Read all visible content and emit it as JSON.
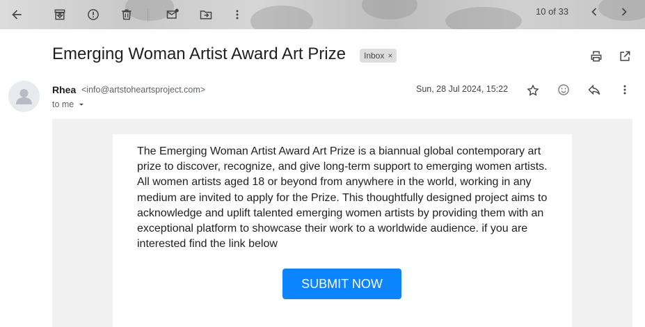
{
  "toolbar": {
    "buttons": [
      "back-icon",
      "archive-icon",
      "report-spam-icon",
      "delete-icon",
      "mark-unread-icon",
      "move-to-icon",
      "more-vert-icon"
    ],
    "pager": "10 of 33"
  },
  "email": {
    "subject": "Emerging Woman Artist Award Art Prize",
    "label": "Inbox",
    "label_close": "×",
    "sender_name": "Rhea",
    "sender_email": "<info@artstoheartsproject.com>",
    "recipient": "to me",
    "date": "Sun, 28 Jul 2024, 15:22",
    "body": "The Emerging Woman Artist Award Art Prize is a biannual global contemporary art prize to discover, recognize, and give long-term support to emerging women artists. All women artists aged 18 or beyond from anywhere in the world, working in any medium are invited to apply for the Prize. This thoughtfully designed project aims to acknowledge and uplift talented emerging women artists by providing them with an exceptional platform to showcase their work to a worldwide audience. if you are interested find the link below",
    "cta": "SUBMIT NOW"
  },
  "colors": {
    "cta": "#0b84ff",
    "body_background": "#f1f1f2",
    "chip": "#dddddd"
  }
}
